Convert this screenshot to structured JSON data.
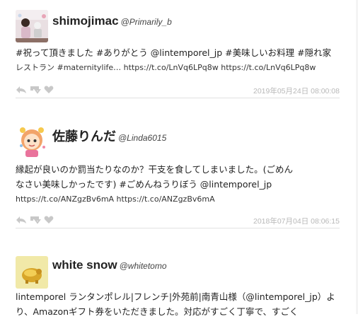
{
  "tweets": [
    {
      "name": "shimojimac",
      "handle": "@Primarily_b",
      "text_line1": "#祝って頂きました #ありがとう @lintemporel_jp #美味しいお料理 #隠れ家",
      "text_line2": "レストラン #maternitylife… https://t.co/LnVq6LPq8w https://t.co/LnVq6LPq8w",
      "date": "2019年05月24日 08:00:08",
      "avatar_icon": "user-photo-party"
    },
    {
      "name": "佐藤りんだ",
      "handle": "@Linda6015",
      "text_line1": "縁起が良いのか罰当たりなのか？干支を食してしまいました。(ごめん",
      "text_line2": "なさい美味しかったです) #ごめんねうりぼう @lintemporel_jp",
      "text_line3": "https://t.co/ANZgzBv6mA https://t.co/ANZgzBv6mA",
      "date": "2018年07月04日 08:06:15",
      "avatar_icon": "cartoon-girl-avatar"
    },
    {
      "name": "white snow",
      "handle": "@whitetomo",
      "text_line1": "lintemporel ランタンポレル|フレンチ|外苑前|南青山様（@lintemporel_jp）よ",
      "text_line2": "り、Amazonギフト券をいただきました。対応がすごく丁寧で、すごく",
      "avatar_icon": "gold-piggy-avatar"
    }
  ],
  "colors": {
    "action_icons": "#c8c8c8",
    "date": "#b8b8b8",
    "rule": "#e2e2e2"
  }
}
